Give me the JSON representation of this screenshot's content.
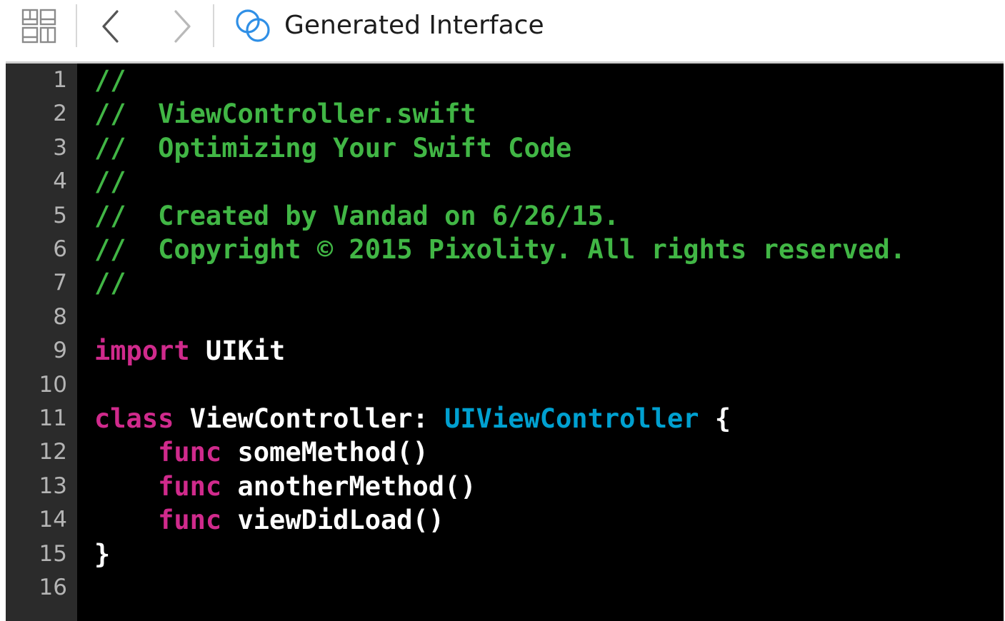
{
  "toolbar": {
    "title": "Generated Interface",
    "icons": [
      "related-items-grid-icon",
      "back-chevron-icon",
      "forward-chevron-icon",
      "generated-interface-icon"
    ],
    "accent_color": "#2f8fe6"
  },
  "editor": {
    "colors": {
      "background": "#000000",
      "gutter": "#2b2b2b",
      "line_number": "#b4b4b4",
      "comment": "#41b645",
      "keyword": "#d02a8c",
      "type": "#00a0d0",
      "plain": "#ffffff"
    },
    "lines": [
      {
        "number": "1",
        "tokens": [
          {
            "kind": "comment",
            "text": "//"
          }
        ]
      },
      {
        "number": "2",
        "tokens": [
          {
            "kind": "comment",
            "text": "//  ViewController.swift"
          }
        ]
      },
      {
        "number": "3",
        "tokens": [
          {
            "kind": "comment",
            "text": "//  Optimizing Your Swift Code"
          }
        ]
      },
      {
        "number": "4",
        "tokens": [
          {
            "kind": "comment",
            "text": "//"
          }
        ]
      },
      {
        "number": "5",
        "tokens": [
          {
            "kind": "comment",
            "text": "//  Created by Vandad on 6/26/15."
          }
        ]
      },
      {
        "number": "6",
        "tokens": [
          {
            "kind": "comment",
            "text": "//  Copyright © 2015 Pixolity. All rights reserved."
          }
        ]
      },
      {
        "number": "7",
        "tokens": [
          {
            "kind": "comment",
            "text": "//"
          }
        ]
      },
      {
        "number": "8",
        "tokens": []
      },
      {
        "number": "9",
        "tokens": [
          {
            "kind": "keyword",
            "text": "import"
          },
          {
            "kind": "plain",
            "text": " UIKit"
          }
        ]
      },
      {
        "number": "10",
        "tokens": []
      },
      {
        "number": "11",
        "tokens": [
          {
            "kind": "keyword",
            "text": "class"
          },
          {
            "kind": "plain",
            "text": " ViewController: "
          },
          {
            "kind": "type",
            "text": "UIViewController"
          },
          {
            "kind": "plain",
            "text": " {"
          }
        ]
      },
      {
        "number": "12",
        "tokens": [
          {
            "kind": "plain",
            "text": "    "
          },
          {
            "kind": "keyword",
            "text": "func"
          },
          {
            "kind": "plain",
            "text": " someMethod()"
          }
        ]
      },
      {
        "number": "13",
        "tokens": [
          {
            "kind": "plain",
            "text": "    "
          },
          {
            "kind": "keyword",
            "text": "func"
          },
          {
            "kind": "plain",
            "text": " anotherMethod()"
          }
        ]
      },
      {
        "number": "14",
        "tokens": [
          {
            "kind": "plain",
            "text": "    "
          },
          {
            "kind": "keyword",
            "text": "func"
          },
          {
            "kind": "plain",
            "text": " viewDidLoad()"
          }
        ]
      },
      {
        "number": "15",
        "tokens": [
          {
            "kind": "plain",
            "text": "}"
          }
        ]
      },
      {
        "number": "16",
        "tokens": []
      }
    ]
  }
}
